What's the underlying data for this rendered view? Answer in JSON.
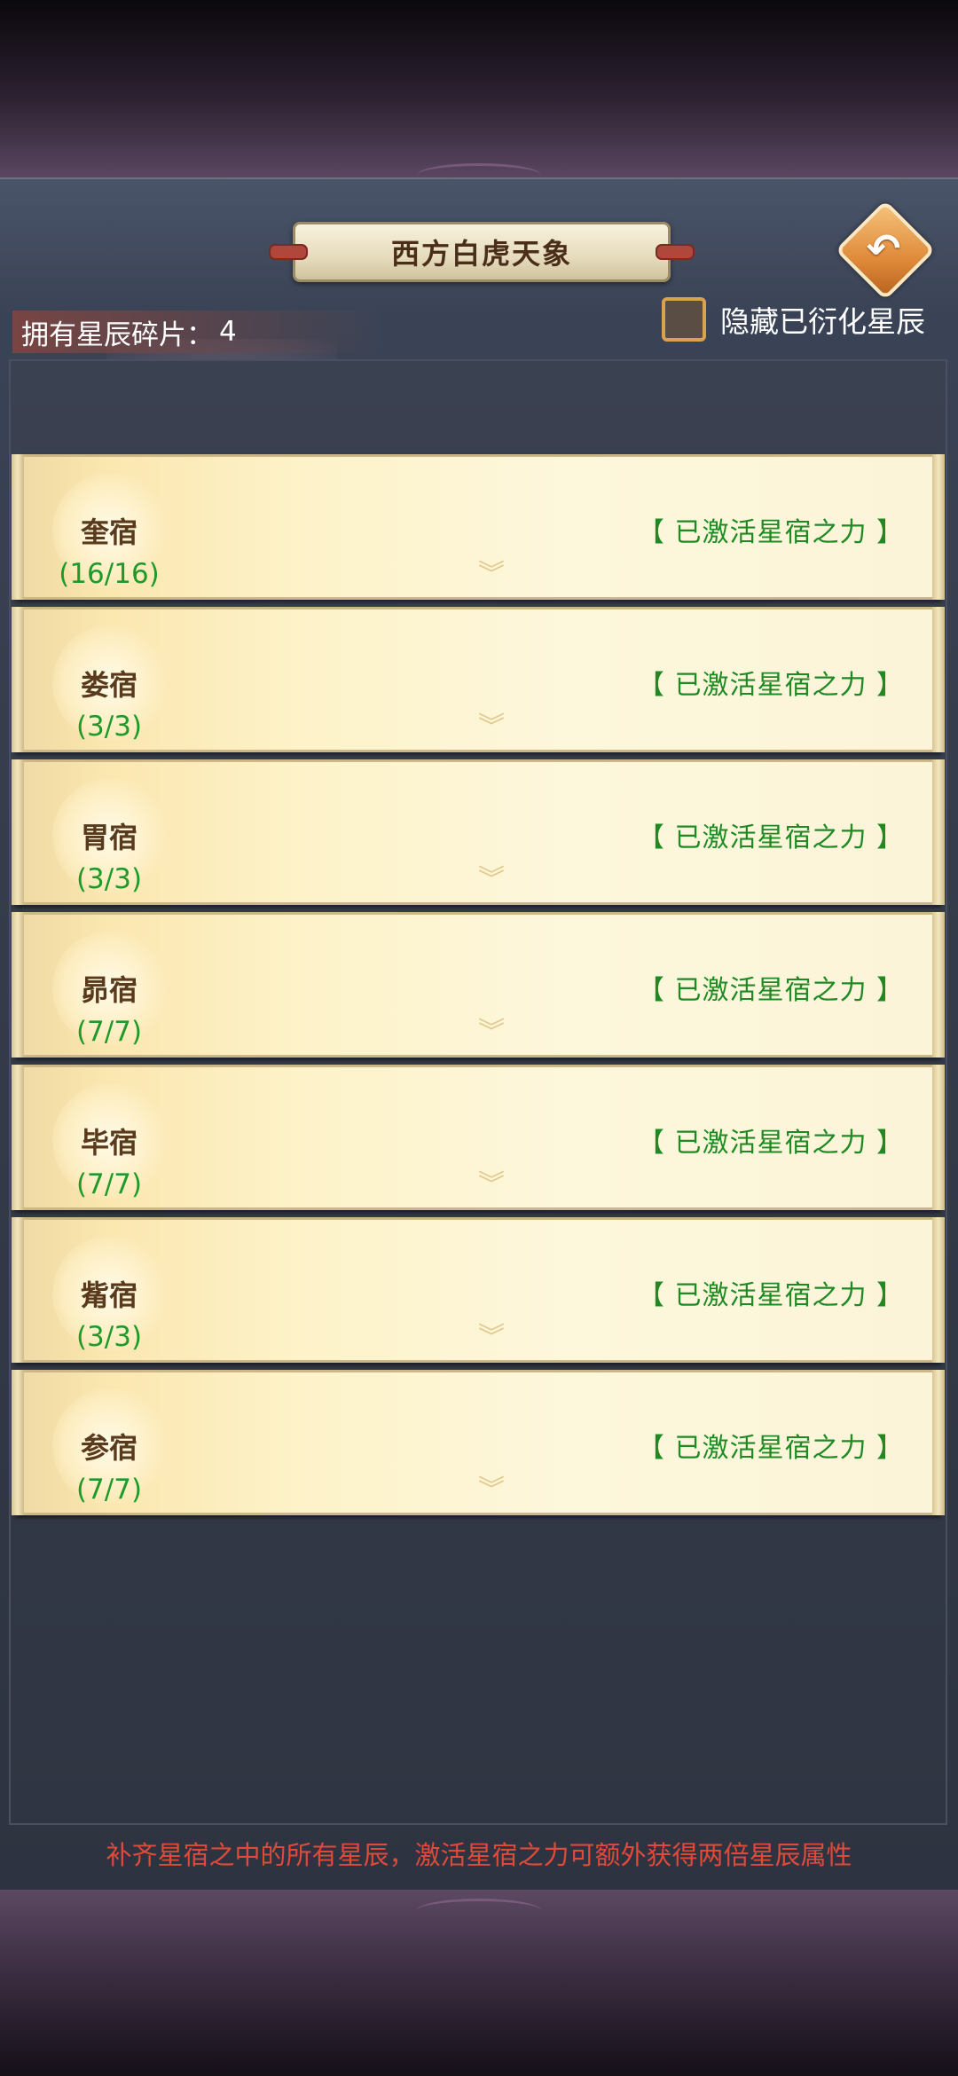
{
  "header": {
    "title": "西方白虎天象",
    "back_icon": "back-arrow-icon"
  },
  "fragments": {
    "label": "拥有星辰碎片：",
    "count": "4"
  },
  "hide_toggle": {
    "label": "隐藏已衍化星辰",
    "checked": false
  },
  "constellations": [
    {
      "name": "奎宿",
      "progress": "(16/16)",
      "status": "【 已激活星宿之力 】"
    },
    {
      "name": "娄宿",
      "progress": "(3/3)",
      "status": "【 已激活星宿之力 】"
    },
    {
      "name": "胃宿",
      "progress": "(3/3)",
      "status": "【 已激活星宿之力 】"
    },
    {
      "name": "昴宿",
      "progress": "(7/7)",
      "status": "【 已激活星宿之力 】"
    },
    {
      "name": "毕宿",
      "progress": "(7/7)",
      "status": "【 已激活星宿之力 】"
    },
    {
      "name": "觜宿",
      "progress": "(3/3)",
      "status": "【 已激活星宿之力 】"
    },
    {
      "name": "参宿",
      "progress": "(7/7)",
      "status": "【 已激活星宿之力 】"
    }
  ],
  "footer": {
    "tip": "补齐星宿之中的所有星辰，激活星宿之力可额外获得两倍星辰属性"
  },
  "colors": {
    "status_green": "#1f8a24",
    "tip_red": "#e04a3a",
    "back_button": "#e08a3a"
  }
}
